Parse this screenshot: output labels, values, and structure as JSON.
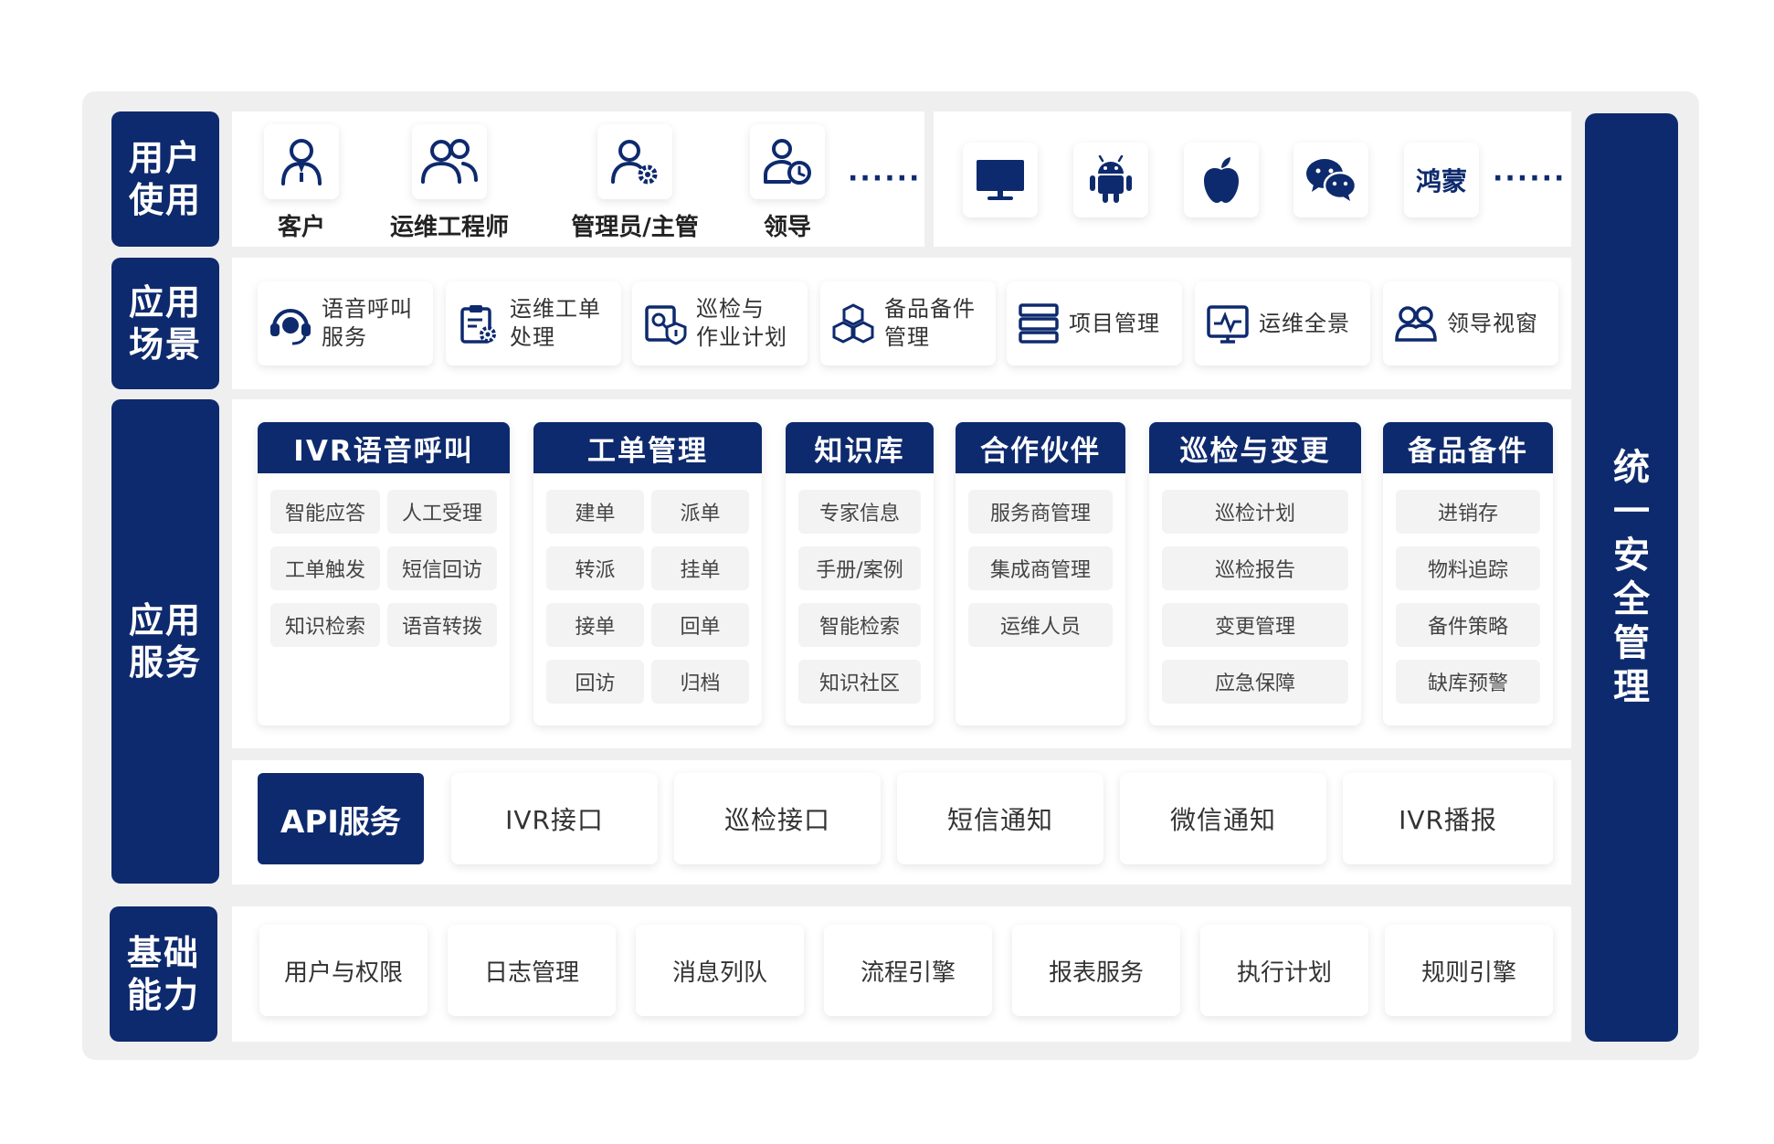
{
  "left_labels": {
    "user_use": [
      "用户",
      "使用"
    ],
    "scenarios": [
      "应用",
      "场景"
    ],
    "services": [
      "应用",
      "服务"
    ],
    "base": [
      "基础",
      "能力"
    ]
  },
  "users": [
    {
      "label": "客户",
      "icon": "user-icon"
    },
    {
      "label": "运维工程师",
      "icon": "users-icon"
    },
    {
      "label": "管理员/主管",
      "icon": "user-gear-icon"
    },
    {
      "label": "领导",
      "icon": "user-clock-icon"
    }
  ],
  "users_more": "······",
  "platforms": [
    {
      "icon": "monitor-icon"
    },
    {
      "icon": "android-icon"
    },
    {
      "icon": "apple-icon"
    },
    {
      "icon": "wechat-icon"
    },
    {
      "label": "鸿蒙"
    }
  ],
  "platforms_more": "······",
  "scenarios": [
    {
      "label": "语音呼叫\n服务",
      "icon": "headset-icon"
    },
    {
      "label": "运维工单\n处理",
      "icon": "clipboard-gear-icon"
    },
    {
      "label": "巡检与\n作业计划",
      "icon": "inspection-icon"
    },
    {
      "label": "备品备件\n管理",
      "icon": "cubes-icon"
    },
    {
      "label": "项目管理",
      "icon": "server-list-icon"
    },
    {
      "label": "运维全景",
      "icon": "monitor-pulse-icon"
    },
    {
      "label": "领导视窗",
      "icon": "group-icon"
    }
  ],
  "services": [
    {
      "title": "IVR语音呼叫",
      "items": [
        "智能应答",
        "人工受理",
        "工单触发",
        "短信回访",
        "知识检索",
        "语音转拨"
      ]
    },
    {
      "title": "工单管理",
      "items": [
        "建单",
        "派单",
        "转派",
        "挂单",
        "接单",
        "回单",
        "回访",
        "归档"
      ]
    },
    {
      "title": "知识库",
      "items": [
        "专家信息",
        "手册/案例",
        "智能检索",
        "知识社区"
      ]
    },
    {
      "title": "合作伙伴",
      "items": [
        "服务商管理",
        "集成商管理",
        "运维人员"
      ]
    },
    {
      "title": "巡检与变更",
      "items": [
        "巡检计划",
        "巡检报告",
        "变更管理",
        "应急保障"
      ]
    },
    {
      "title": "备品备件",
      "items": [
        "进销存",
        "物料追踪",
        "备件策略",
        "缺库预警"
      ]
    }
  ],
  "api": {
    "title": "API服务",
    "items": [
      "IVR接口",
      "巡检接口",
      "短信通知",
      "微信通知",
      "IVR播报"
    ]
  },
  "base": [
    "用户与权限",
    "日志管理",
    "消息列队",
    "流程引擎",
    "报表服务",
    "执行计划",
    "规则引擎"
  ],
  "security": [
    "统",
    "一",
    "安",
    "全",
    "管",
    "理"
  ],
  "colors": {
    "navy": "#0e2a6e",
    "frame": "#efefef"
  }
}
